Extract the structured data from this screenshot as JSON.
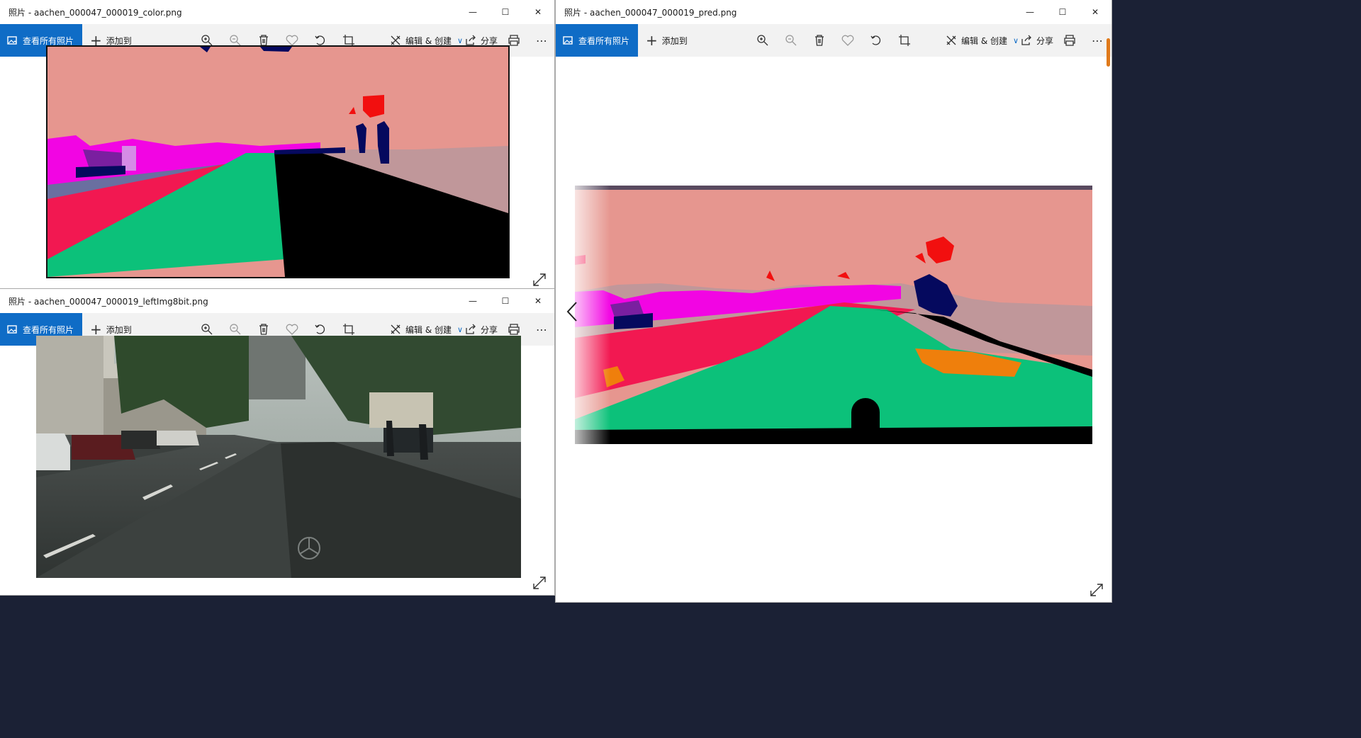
{
  "windows": [
    {
      "id": "color",
      "title": "照片 - aachen_000047_000019_color.png",
      "image_name": "color-segmentation-image"
    },
    {
      "id": "left",
      "title": "照片 - aachen_000047_000019_leftImg8bit.png",
      "image_name": "street-photo-image"
    },
    {
      "id": "pred",
      "title": "照片 - aachen_000047_000019_pred.png",
      "image_name": "predicted-segmentation-image"
    }
  ],
  "toolbar": {
    "view_all_label": "查看所有照片",
    "add_to_label": "添加到",
    "edit_create_label": "编辑 & 创建",
    "share_label": "分享"
  },
  "icons": [
    "zoom-in-icon",
    "zoom-out-icon",
    "delete-icon",
    "favorite-icon",
    "rotate-icon",
    "crop-icon",
    "edit-icon",
    "share-icon",
    "print-icon",
    "more-icon",
    "expand-icon",
    "prev-arrow-icon",
    "minimize-icon",
    "maximize-icon",
    "close-icon"
  ],
  "colors": {
    "accent": "#0f6cc6",
    "sky": "#e6968f",
    "road": "#f21851",
    "sidewalk": "#0cc17a",
    "void": "#000000",
    "building": "#f205e3",
    "person": "#05095e",
    "wall": "#c0979a",
    "orange": "#ef7f0c"
  }
}
